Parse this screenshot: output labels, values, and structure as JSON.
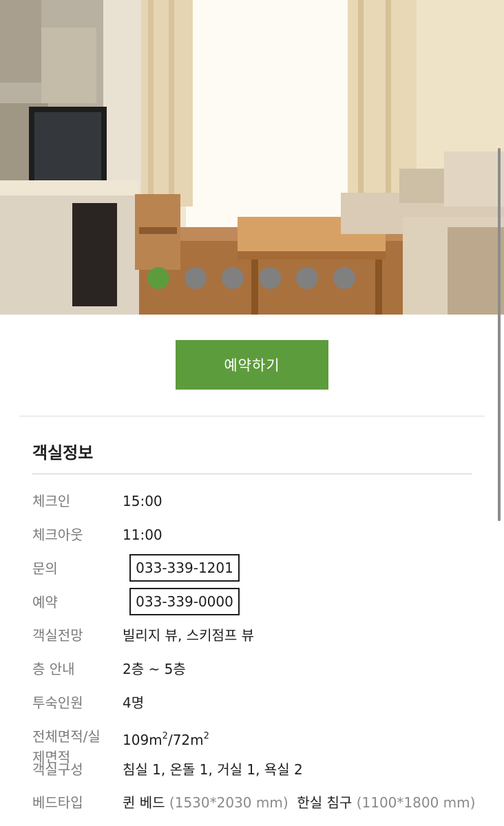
{
  "hero": {
    "slide_count": 6,
    "active_slide": 1
  },
  "reserve_button": {
    "label": "예약하기"
  },
  "room_info": {
    "title": "객실정보",
    "checkin": {
      "label": "체크인",
      "value": "15:00"
    },
    "checkout": {
      "label": "체크아웃",
      "value": "11:00"
    },
    "inquiry": {
      "label": "문의",
      "value": "033-339-1201"
    },
    "reservation": {
      "label": "예약",
      "value": "033-339-0000"
    },
    "view": {
      "label": "객실전망",
      "value": "빌리지 뷰, 스키점프 뷰"
    },
    "floor": {
      "label": "층 안내",
      "value": "2층 ~ 5층"
    },
    "capacity": {
      "label": "투숙인원",
      "value": "4명"
    },
    "area": {
      "label": "전체면적/실제면적",
      "value_total": "109m",
      "value_real": "72m",
      "sup": "2",
      "sep": "/"
    },
    "composition": {
      "label": "객실구성",
      "value": "침실 1, 온돌 1, 거실 1, 욕실 2"
    },
    "bed": {
      "label": "베드타입",
      "queen": "퀸 베드",
      "queen_size": "(1530*2030 mm)",
      "korean": "한실 침구",
      "korean_size": "(1100*1800 mm)"
    }
  },
  "colors": {
    "accent": "#5d9c3c",
    "dot_inactive": "#808080"
  }
}
